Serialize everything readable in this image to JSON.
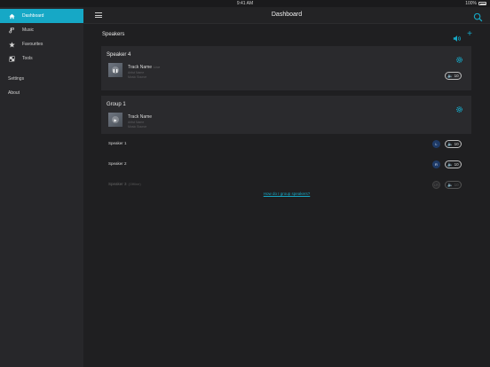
{
  "status": {
    "time": "9:41 AM",
    "battery": "100%"
  },
  "sidebar": {
    "items": [
      {
        "label": "Dashboard",
        "icon": "home-icon"
      },
      {
        "label": "Music",
        "icon": "music-note-icon"
      },
      {
        "label": "Favourites",
        "icon": "star-icon"
      },
      {
        "label": "Tools",
        "icon": "tools-icon"
      }
    ],
    "secondary": [
      {
        "label": "Settings"
      },
      {
        "label": "About"
      }
    ]
  },
  "topbar": {
    "title": "Dashboard"
  },
  "speakers": {
    "title": "Speakers",
    "cards": [
      {
        "title": "Speaker 4",
        "track_name": "Track Name",
        "track_suffix": "Live",
        "artist": "Artist Name",
        "source": "Music Source",
        "volume": "10"
      },
      {
        "title": "Group 1",
        "track_name": "Track Name",
        "artist": "Artist Name",
        "source": "Music Source"
      }
    ],
    "group_members": [
      {
        "name": "Speaker 1",
        "badge": "L",
        "volume": "10"
      },
      {
        "name": "Speaker 2",
        "badge": "R",
        "volume": "10"
      },
      {
        "name": "Speaker 3",
        "status": "(Offline)",
        "badge": "LR",
        "volume": "10"
      }
    ],
    "help_link": "How do I group speakers?"
  },
  "colors": {
    "accent": "#16a8c6",
    "badge": "#1e3a66",
    "background": "#1f1f21",
    "sidebar": "#27272a",
    "card": "#2a2a2d"
  }
}
